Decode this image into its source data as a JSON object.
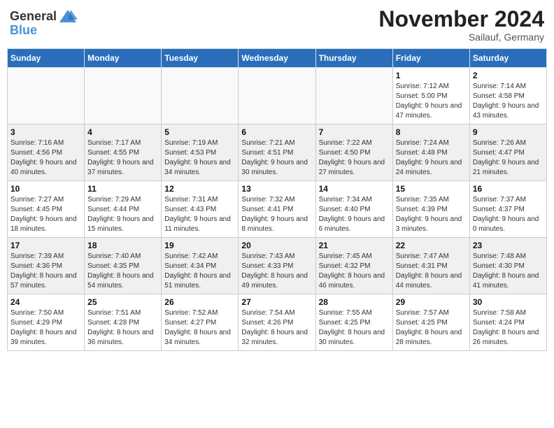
{
  "header": {
    "logo_general": "General",
    "logo_blue": "Blue",
    "month": "November 2024",
    "location": "Sailauf, Germany"
  },
  "days_of_week": [
    "Sunday",
    "Monday",
    "Tuesday",
    "Wednesday",
    "Thursday",
    "Friday",
    "Saturday"
  ],
  "weeks": [
    [
      {
        "day": "",
        "info": ""
      },
      {
        "day": "",
        "info": ""
      },
      {
        "day": "",
        "info": ""
      },
      {
        "day": "",
        "info": ""
      },
      {
        "day": "",
        "info": ""
      },
      {
        "day": "1",
        "info": "Sunrise: 7:12 AM\nSunset: 5:00 PM\nDaylight: 9 hours and 47 minutes."
      },
      {
        "day": "2",
        "info": "Sunrise: 7:14 AM\nSunset: 4:58 PM\nDaylight: 9 hours and 43 minutes."
      }
    ],
    [
      {
        "day": "3",
        "info": "Sunrise: 7:16 AM\nSunset: 4:56 PM\nDaylight: 9 hours and 40 minutes."
      },
      {
        "day": "4",
        "info": "Sunrise: 7:17 AM\nSunset: 4:55 PM\nDaylight: 9 hours and 37 minutes."
      },
      {
        "day": "5",
        "info": "Sunrise: 7:19 AM\nSunset: 4:53 PM\nDaylight: 9 hours and 34 minutes."
      },
      {
        "day": "6",
        "info": "Sunrise: 7:21 AM\nSunset: 4:51 PM\nDaylight: 9 hours and 30 minutes."
      },
      {
        "day": "7",
        "info": "Sunrise: 7:22 AM\nSunset: 4:50 PM\nDaylight: 9 hours and 27 minutes."
      },
      {
        "day": "8",
        "info": "Sunrise: 7:24 AM\nSunset: 4:48 PM\nDaylight: 9 hours and 24 minutes."
      },
      {
        "day": "9",
        "info": "Sunrise: 7:26 AM\nSunset: 4:47 PM\nDaylight: 9 hours and 21 minutes."
      }
    ],
    [
      {
        "day": "10",
        "info": "Sunrise: 7:27 AM\nSunset: 4:45 PM\nDaylight: 9 hours and 18 minutes."
      },
      {
        "day": "11",
        "info": "Sunrise: 7:29 AM\nSunset: 4:44 PM\nDaylight: 9 hours and 15 minutes."
      },
      {
        "day": "12",
        "info": "Sunrise: 7:31 AM\nSunset: 4:43 PM\nDaylight: 9 hours and 11 minutes."
      },
      {
        "day": "13",
        "info": "Sunrise: 7:32 AM\nSunset: 4:41 PM\nDaylight: 9 hours and 8 minutes."
      },
      {
        "day": "14",
        "info": "Sunrise: 7:34 AM\nSunset: 4:40 PM\nDaylight: 9 hours and 6 minutes."
      },
      {
        "day": "15",
        "info": "Sunrise: 7:35 AM\nSunset: 4:39 PM\nDaylight: 9 hours and 3 minutes."
      },
      {
        "day": "16",
        "info": "Sunrise: 7:37 AM\nSunset: 4:37 PM\nDaylight: 9 hours and 0 minutes."
      }
    ],
    [
      {
        "day": "17",
        "info": "Sunrise: 7:39 AM\nSunset: 4:36 PM\nDaylight: 8 hours and 57 minutes."
      },
      {
        "day": "18",
        "info": "Sunrise: 7:40 AM\nSunset: 4:35 PM\nDaylight: 8 hours and 54 minutes."
      },
      {
        "day": "19",
        "info": "Sunrise: 7:42 AM\nSunset: 4:34 PM\nDaylight: 8 hours and 51 minutes."
      },
      {
        "day": "20",
        "info": "Sunrise: 7:43 AM\nSunset: 4:33 PM\nDaylight: 8 hours and 49 minutes."
      },
      {
        "day": "21",
        "info": "Sunrise: 7:45 AM\nSunset: 4:32 PM\nDaylight: 8 hours and 46 minutes."
      },
      {
        "day": "22",
        "info": "Sunrise: 7:47 AM\nSunset: 4:31 PM\nDaylight: 8 hours and 44 minutes."
      },
      {
        "day": "23",
        "info": "Sunrise: 7:48 AM\nSunset: 4:30 PM\nDaylight: 8 hours and 41 minutes."
      }
    ],
    [
      {
        "day": "24",
        "info": "Sunrise: 7:50 AM\nSunset: 4:29 PM\nDaylight: 8 hours and 39 minutes."
      },
      {
        "day": "25",
        "info": "Sunrise: 7:51 AM\nSunset: 4:28 PM\nDaylight: 8 hours and 36 minutes."
      },
      {
        "day": "26",
        "info": "Sunrise: 7:52 AM\nSunset: 4:27 PM\nDaylight: 8 hours and 34 minutes."
      },
      {
        "day": "27",
        "info": "Sunrise: 7:54 AM\nSunset: 4:26 PM\nDaylight: 8 hours and 32 minutes."
      },
      {
        "day": "28",
        "info": "Sunrise: 7:55 AM\nSunset: 4:25 PM\nDaylight: 8 hours and 30 minutes."
      },
      {
        "day": "29",
        "info": "Sunrise: 7:57 AM\nSunset: 4:25 PM\nDaylight: 8 hours and 28 minutes."
      },
      {
        "day": "30",
        "info": "Sunrise: 7:58 AM\nSunset: 4:24 PM\nDaylight: 8 hours and 26 minutes."
      }
    ]
  ]
}
